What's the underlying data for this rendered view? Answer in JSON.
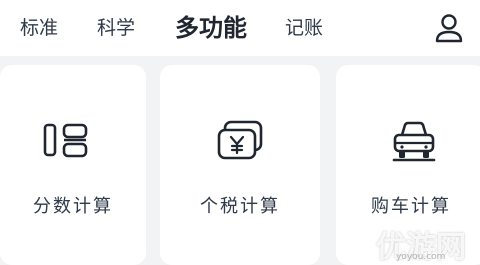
{
  "tabs": [
    {
      "label": "标准"
    },
    {
      "label": "科学"
    },
    {
      "label": "多功能",
      "active": true
    },
    {
      "label": "记账"
    }
  ],
  "header": {
    "user_icon": "user-profile-icon"
  },
  "cards": [
    {
      "label": "分数计算",
      "icon": "fraction-icon"
    },
    {
      "label": "个税计算",
      "icon": "yuan-money-icon"
    },
    {
      "label": "购车计算",
      "icon": "car-icon"
    }
  ],
  "watermark": {
    "text": "优游网",
    "sub": "yoyou.com"
  },
  "colors": {
    "background": "#f2f3f5",
    "card": "#ffffff",
    "text": "#2f3a4a",
    "icon": "#1f2630"
  }
}
